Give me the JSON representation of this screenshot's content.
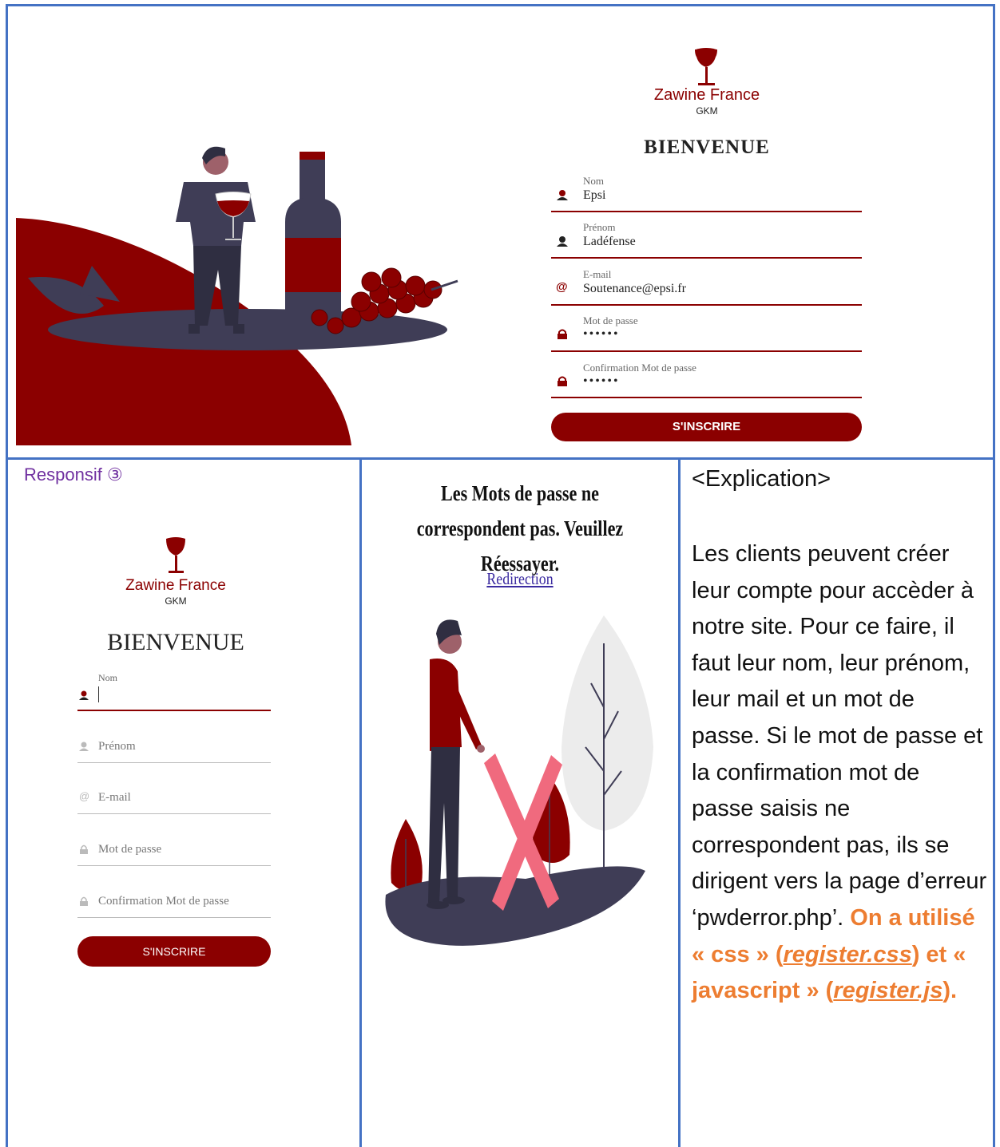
{
  "desktop": {
    "brand_name": "Zawine France",
    "brand_sub": "GKM",
    "heading": "BIENVENUE",
    "fields": [
      {
        "label": "Nom",
        "value": "Epsi",
        "icon": "user-icon"
      },
      {
        "label": "Prénom",
        "value": "Ladéfense",
        "icon": "user-icon"
      },
      {
        "label": "E-mail",
        "value": "Soutenance@epsi.fr",
        "icon": "at-icon"
      },
      {
        "label": "Mot de passe",
        "value": "••••••",
        "icon": "lock-icon"
      },
      {
        "label": "Confirmation Mot de passe",
        "value": "••••••",
        "icon": "lock-icon"
      }
    ],
    "submit_label": "S'INSCRIRE"
  },
  "responsive": {
    "caption": "Responsif ③",
    "brand_name": "Zawine France",
    "brand_sub": "GKM",
    "heading": "BIENVENUE",
    "active_field_label": "Nom",
    "placeholders": [
      "Prénom",
      "E-mail",
      "Mot de passe",
      "Confirmation Mot de passe"
    ],
    "submit_label": "S'INSCRIRE"
  },
  "error_page": {
    "message": "Les Mots de passe ne correspondent pas. Veuillez Réessayer.",
    "link_label": "Redirection"
  },
  "explanation": {
    "title": "<Explication>",
    "body": " Les clients peuvent créer leur compte pour accèder à notre site. Pour ce faire, il faut leur nom, leur prénom, leur mail et un mot de passe. Si le mot de passe et la confirmation mot de passe saisis ne correspondent pas, ils se dirigent vers la page d’erreur ‘pwderror.php’. ",
    "highlight_1": "On a utilisé  « css » (",
    "file_css": "register.css",
    "highlight_2": ") et « javascript » (",
    "file_js": "register.js",
    "highlight_3": ")."
  },
  "colors": {
    "brand": "#8b0000",
    "border": "#4472c4",
    "accent": "#ed7d31",
    "caption": "#7030a0"
  }
}
